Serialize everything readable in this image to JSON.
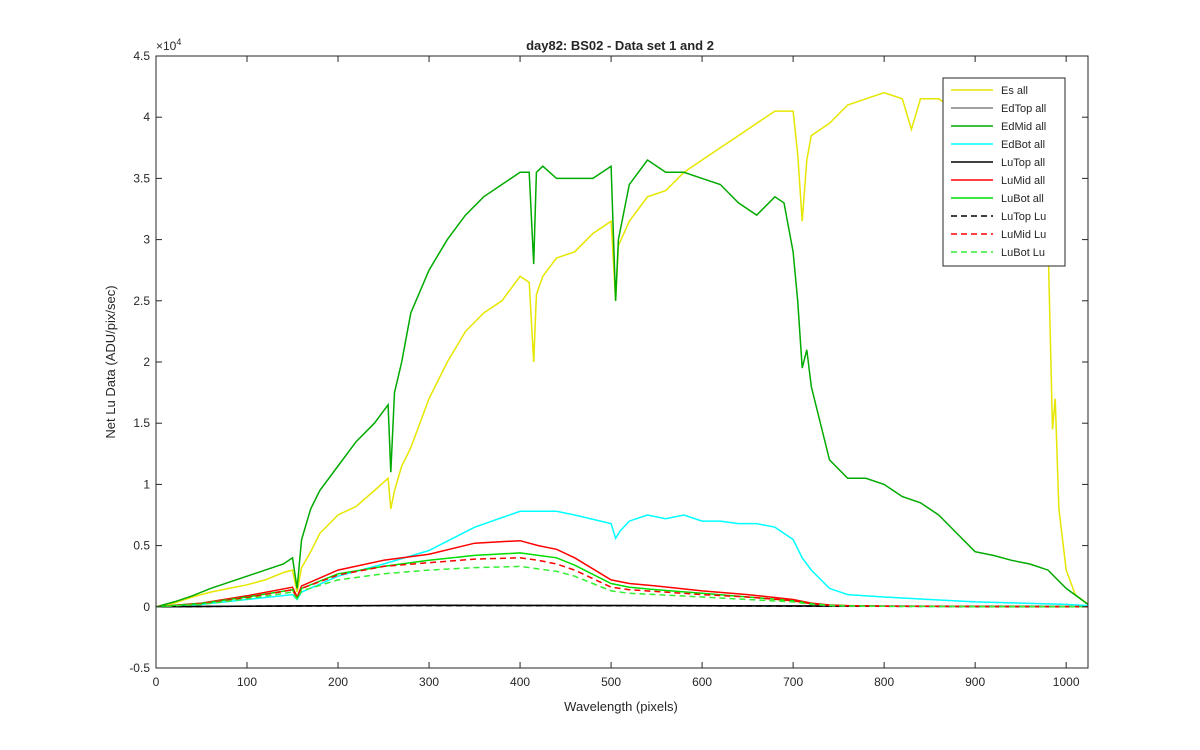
{
  "chart_data": {
    "type": "line",
    "title": "day82: BS02 - Data set 1 and 2",
    "xlabel": "Wavelength (pixels)",
    "ylabel": "Net Lu Data (ADU/pix/sec)",
    "y_exponent_label": "×10",
    "y_exponent_power": "4",
    "xlim": [
      0,
      1024
    ],
    "ylim": [
      -5000,
      45000
    ],
    "x_ticks": [
      0,
      100,
      200,
      300,
      400,
      500,
      600,
      700,
      800,
      900,
      1000
    ],
    "y_ticks": [
      -5000,
      0,
      5000,
      10000,
      15000,
      20000,
      25000,
      30000,
      35000,
      40000,
      45000
    ],
    "y_tick_labels": [
      "-0.5",
      "0",
      "0.5",
      "1",
      "1.5",
      "2",
      "2.5",
      "3",
      "3.5",
      "4",
      "4.5"
    ],
    "grid": false,
    "legend_position": "top-right",
    "series": [
      {
        "name": "Es  all",
        "color": "#e6e600",
        "style": "solid",
        "x": [
          0,
          20,
          40,
          60,
          80,
          100,
          120,
          140,
          150,
          155,
          160,
          170,
          180,
          200,
          220,
          240,
          255,
          258,
          262,
          270,
          280,
          300,
          320,
          340,
          360,
          380,
          400,
          410,
          415,
          418,
          425,
          440,
          460,
          480,
          500,
          505,
          508,
          520,
          540,
          560,
          580,
          600,
          620,
          640,
          660,
          680,
          700,
          705,
          710,
          715,
          720,
          740,
          760,
          780,
          800,
          820,
          830,
          840,
          860,
          880,
          900,
          920,
          940,
          960,
          975,
          980,
          985,
          988,
          992,
          1000,
          1010,
          1024
        ],
        "y": [
          0,
          300,
          800,
          1200,
          1500,
          1800,
          2200,
          2800,
          3000,
          1200,
          3200,
          4500,
          6000,
          7500,
          8200,
          9500,
          10500,
          8000,
          9500,
          11500,
          13000,
          17000,
          20000,
          22500,
          24000,
          25000,
          27000,
          26500,
          20000,
          25500,
          27000,
          28500,
          29000,
          30500,
          31500,
          25000,
          29500,
          31500,
          33500,
          34000,
          35500,
          36500,
          37500,
          38500,
          39500,
          40500,
          40500,
          37000,
          31500,
          36500,
          38500,
          39500,
          41000,
          41500,
          42000,
          41500,
          39000,
          41500,
          41500,
          40500,
          40500,
          41500,
          41000,
          40500,
          38000,
          30000,
          14500,
          17000,
          8000,
          3000,
          1000,
          200
        ]
      },
      {
        "name": "EdTop  all",
        "color": "#808080",
        "style": "solid",
        "x": [
          0,
          100,
          300,
          500,
          700,
          900,
          1024
        ],
        "y": [
          0,
          50,
          100,
          100,
          60,
          30,
          10
        ]
      },
      {
        "name": "EdMid  all",
        "color": "#00aa00",
        "style": "solid",
        "x": [
          0,
          20,
          40,
          60,
          80,
          100,
          120,
          140,
          150,
          155,
          160,
          170,
          180,
          200,
          220,
          240,
          255,
          258,
          262,
          270,
          280,
          300,
          320,
          340,
          360,
          380,
          400,
          410,
          415,
          418,
          425,
          440,
          460,
          480,
          500,
          505,
          508,
          520,
          540,
          560,
          580,
          600,
          620,
          640,
          660,
          680,
          690,
          700,
          705,
          710,
          715,
          720,
          740,
          760,
          780,
          800,
          820,
          840,
          860,
          880,
          900,
          920,
          940,
          960,
          980,
          1000,
          1024
        ],
        "y": [
          0,
          400,
          900,
          1500,
          2000,
          2500,
          3000,
          3500,
          4000,
          1500,
          5500,
          8000,
          9500,
          11500,
          13500,
          15000,
          16500,
          11000,
          17500,
          20000,
          24000,
          27500,
          30000,
          32000,
          33500,
          34500,
          35500,
          35500,
          28000,
          35500,
          36000,
          35000,
          35000,
          35000,
          36000,
          25000,
          30000,
          34500,
          36500,
          35500,
          35500,
          35000,
          34500,
          33000,
          32000,
          33500,
          33000,
          29000,
          25000,
          19500,
          21000,
          18000,
          12000,
          10500,
          10500,
          10000,
          9000,
          8500,
          7500,
          6000,
          4500,
          4200,
          3800,
          3500,
          3000,
          1500,
          200
        ]
      },
      {
        "name": "EdBot  all",
        "color": "#00ffff",
        "style": "solid",
        "x": [
          0,
          50,
          100,
          150,
          155,
          160,
          200,
          250,
          300,
          350,
          400,
          420,
          440,
          460,
          500,
          505,
          510,
          520,
          540,
          560,
          580,
          600,
          620,
          640,
          660,
          680,
          700,
          710,
          720,
          740,
          760,
          800,
          850,
          900,
          950,
          1000,
          1024
        ],
        "y": [
          0,
          200,
          600,
          1000,
          600,
          1200,
          2500,
          3500,
          4600,
          6500,
          7800,
          7800,
          7800,
          7500,
          6800,
          5600,
          6200,
          7000,
          7500,
          7200,
          7500,
          7000,
          7000,
          6800,
          6800,
          6500,
          5500,
          4000,
          3000,
          1500,
          1000,
          800,
          600,
          400,
          300,
          200,
          100
        ]
      },
      {
        "name": "LuTop  all",
        "color": "#000000",
        "style": "solid",
        "x": [
          0,
          100,
          300,
          500,
          700,
          900,
          1024
        ],
        "y": [
          0,
          60,
          120,
          110,
          70,
          30,
          10
        ]
      },
      {
        "name": "LuMid  all",
        "color": "#ff0000",
        "style": "solid",
        "x": [
          0,
          50,
          100,
          150,
          155,
          160,
          200,
          250,
          300,
          350,
          400,
          420,
          440,
          460,
          500,
          520,
          550,
          600,
          650,
          700,
          720,
          740,
          760,
          800,
          900,
          1024
        ],
        "y": [
          0,
          300,
          900,
          1600,
          800,
          1700,
          3000,
          3800,
          4300,
          5200,
          5400,
          5000,
          4700,
          4000,
          2200,
          1900,
          1700,
          1300,
          1000,
          600,
          300,
          150,
          100,
          60,
          40,
          10
        ]
      },
      {
        "name": "LuBot  all",
        "color": "#00dd00",
        "style": "solid",
        "x": [
          0,
          50,
          100,
          150,
          155,
          160,
          200,
          250,
          300,
          350,
          400,
          420,
          440,
          460,
          500,
          520,
          550,
          600,
          650,
          700,
          720,
          740,
          760,
          800,
          900,
          1024
        ],
        "y": [
          0,
          280,
          800,
          1400,
          700,
          1500,
          2700,
          3300,
          3800,
          4200,
          4400,
          4200,
          4000,
          3400,
          1900,
          1600,
          1400,
          1100,
          800,
          500,
          250,
          120,
          80,
          50,
          30,
          10
        ]
      },
      {
        "name": "LuTop  Lu",
        "color": "#000000",
        "style": "dashed",
        "x": [
          0,
          100,
          300,
          500,
          700,
          900,
          1024
        ],
        "y": [
          0,
          50,
          100,
          90,
          60,
          25,
          10
        ]
      },
      {
        "name": "LuMid  Lu",
        "color": "#ff0000",
        "style": "dashed",
        "x": [
          0,
          50,
          100,
          150,
          155,
          160,
          200,
          250,
          300,
          350,
          400,
          420,
          440,
          460,
          500,
          520,
          550,
          600,
          650,
          700,
          720,
          740,
          760,
          800,
          900,
          1024
        ],
        "y": [
          0,
          250,
          750,
          1400,
          700,
          1500,
          2600,
          3300,
          3600,
          3900,
          4000,
          3800,
          3500,
          3000,
          1600,
          1400,
          1250,
          1000,
          800,
          500,
          250,
          120,
          80,
          50,
          30,
          10
        ]
      },
      {
        "name": "LuBot  Lu",
        "color": "#33ee33",
        "style": "dashed",
        "x": [
          0,
          50,
          100,
          150,
          155,
          160,
          200,
          250,
          300,
          350,
          400,
          420,
          440,
          460,
          500,
          520,
          550,
          600,
          650,
          700,
          720,
          740,
          760,
          800,
          900,
          1024
        ],
        "y": [
          0,
          200,
          650,
          1200,
          600,
          1300,
          2200,
          2700,
          3000,
          3200,
          3300,
          3100,
          2900,
          2500,
          1300,
          1100,
          1000,
          800,
          600,
          400,
          200,
          100,
          60,
          40,
          20,
          10
        ]
      }
    ]
  }
}
